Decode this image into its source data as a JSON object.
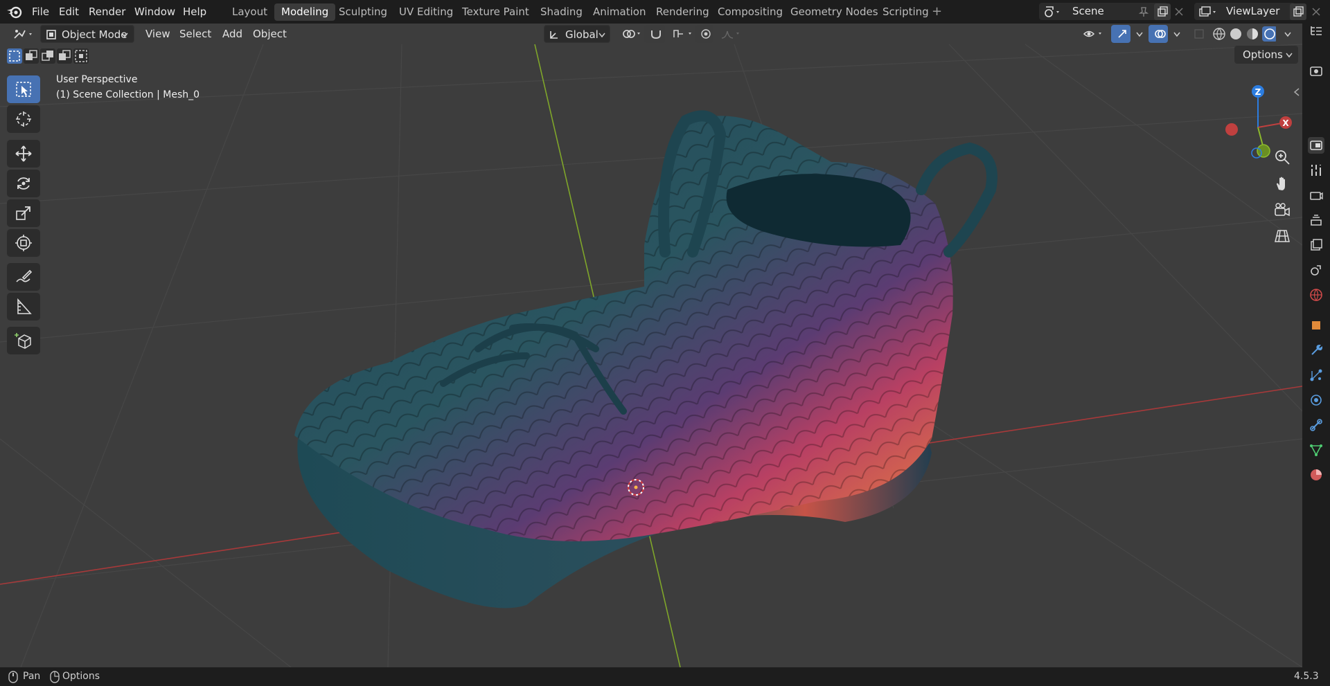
{
  "menu": {
    "file": "File",
    "edit": "Edit",
    "render": "Render",
    "window": "Window",
    "help": "Help"
  },
  "workspaces": [
    {
      "label": "Layout"
    },
    {
      "label": "Modeling"
    },
    {
      "label": "Sculpting"
    },
    {
      "label": "UV Editing"
    },
    {
      "label": "Texture Paint"
    },
    {
      "label": "Shading"
    },
    {
      "label": "Animation"
    },
    {
      "label": "Rendering"
    },
    {
      "label": "Compositing"
    },
    {
      "label": "Geometry Nodes"
    },
    {
      "label": "Scripting"
    }
  ],
  "active_workspace": "Modeling",
  "scene": {
    "name": "Scene"
  },
  "view_layer": {
    "name": "ViewLayer"
  },
  "header": {
    "mode": "Object Mode",
    "view": "View",
    "select": "Select",
    "add": "Add",
    "object": "Object",
    "transform_orientation": "Global",
    "options": "Options"
  },
  "viewport": {
    "perspective": "User Perspective",
    "collection_info": "(1) Scene Collection | Mesh_0"
  },
  "gizmo": {
    "z": "Z",
    "x": "X"
  },
  "status": {
    "pan": "Pan",
    "options": "Options",
    "version": "4.5.3"
  },
  "colors": {
    "accent": "#4772b3",
    "viewport_bg": "#3d3d3d",
    "x_axis": "#c0403f",
    "y_axis": "#8cb82d",
    "z_axis": "#2c7de0"
  }
}
